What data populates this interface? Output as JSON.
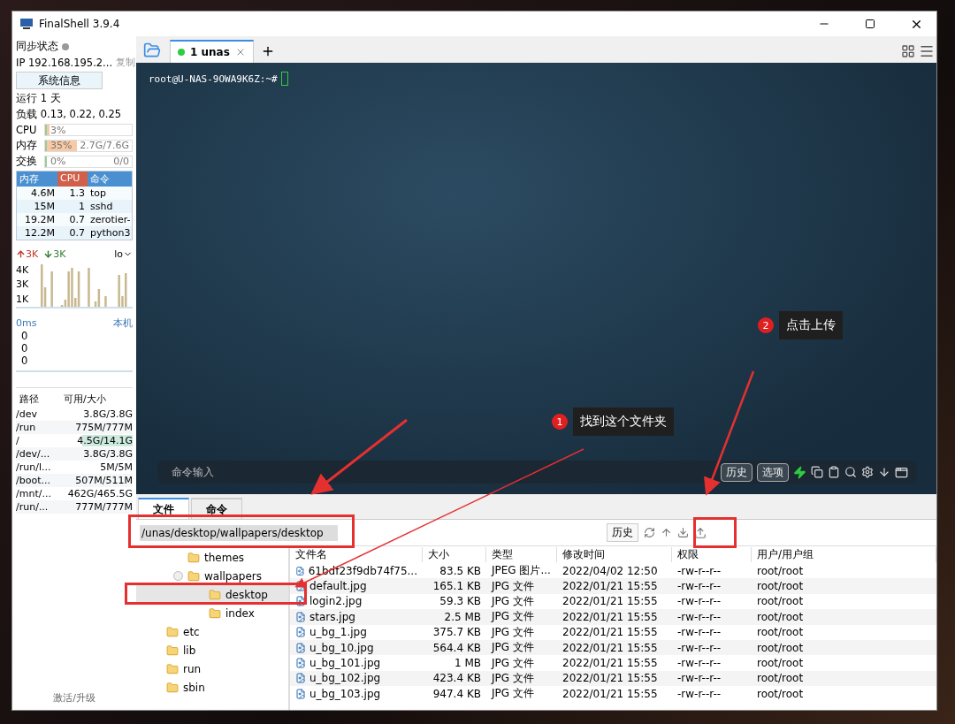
{
  "window": {
    "title": "FinalShell 3.9.4"
  },
  "sidebar": {
    "sync_label": "同步状态",
    "sync_on": false,
    "ip": "IP 192.168.195.2...",
    "copy": "复制",
    "sysinfo_button": "系统信息",
    "uptime": "运行 1 天",
    "load": "负载 0.13, 0.22, 0.25",
    "meters": [
      {
        "label": "CPU",
        "reading": "3%",
        "level": 0.03
      },
      {
        "label": "内存",
        "reading": "35%",
        "level": 0.35,
        "detail": "2.7G/7.6G"
      },
      {
        "label": "交换",
        "reading": "0%",
        "level": 0,
        "detail": "0/0"
      }
    ],
    "process_columns": [
      "内存",
      "CPU",
      "命令"
    ],
    "processes": [
      [
        "4.6M",
        "1.3",
        "top"
      ],
      [
        "15M",
        "1",
        "sshd"
      ],
      [
        "19.2M",
        "0.7",
        "zerotier-"
      ],
      [
        "12.2M",
        "0.7",
        "python3"
      ]
    ],
    "network": {
      "up": "3K",
      "down": "3K",
      "interface": "lo",
      "tick_labels": [
        "4K",
        "3K",
        "1K"
      ]
    },
    "latency": {
      "reading": "0ms",
      "host": "本机",
      "values": [
        "0",
        "0",
        "0"
      ]
    },
    "disk_columns": [
      "路径",
      "可用/大小"
    ],
    "disks": [
      {
        "path": "/dev",
        "usage": "3.8G/3.8G",
        "highlighted": false
      },
      {
        "path": "/run",
        "usage": "775M/777M",
        "highlighted": false
      },
      {
        "path": "/",
        "usage": "4.5G/14.1G",
        "highlighted": true
      },
      {
        "path": "/dev/...",
        "usage": "3.8G/3.8G",
        "highlighted": false
      },
      {
        "path": "/run/l...",
        "usage": "5M/5M",
        "highlighted": false
      },
      {
        "path": "/boot...",
        "usage": "507M/511M",
        "highlighted": false
      },
      {
        "path": "/mnt/...",
        "usage": "462G/465.5G",
        "highlighted": false
      },
      {
        "path": "/run/...",
        "usage": "777M/777M",
        "highlighted": false
      }
    ],
    "footer": "激活/升级"
  },
  "session_tabs": [
    {
      "label": "1 unas",
      "selected": true,
      "connected": true
    }
  ],
  "terminal": {
    "prompt": "root@U-NAS-9OWA9K6Z:~#",
    "command_placeholder": "命令输入",
    "buttons": [
      "历史",
      "选项"
    ]
  },
  "file_panel": {
    "tabs": [
      {
        "label": "文件",
        "selected": true
      },
      {
        "label": "命令",
        "selected": false
      }
    ],
    "path": "/unas/desktop/wallpapers/desktop",
    "history_button": "历史",
    "tree": [
      {
        "children": [
          {
            "name": "themes",
            "selected": false
          },
          {
            "name": "wallpapers",
            "selected": false,
            "expanded": true,
            "children": [
              {
                "name": "desktop",
                "selected": true
              },
              {
                "name": "index",
                "selected": false
              }
            ]
          }
        ]
      },
      {
        "name": "etc",
        "selected": false
      },
      {
        "name": "lib",
        "selected": false
      },
      {
        "name": "run",
        "selected": false
      },
      {
        "name": "sbin",
        "selected": false
      }
    ],
    "columns": [
      "文件名",
      "大小",
      "类型",
      "修改时间",
      "权限",
      "用户/用户组"
    ],
    "files": [
      [
        "61bdf23f9db74f75...",
        "83.5 KB",
        "JPEG 图片...",
        "2022/04/02 12:50",
        "-rw-r--r--",
        "root/root"
      ],
      [
        "default.jpg",
        "165.1 KB",
        "JPG 文件",
        "2022/01/21 15:55",
        "-rw-r--r--",
        "root/root"
      ],
      [
        "login2.jpg",
        "59.3 KB",
        "JPG 文件",
        "2022/01/21 15:55",
        "-rw-r--r--",
        "root/root"
      ],
      [
        "stars.jpg",
        "2.5 MB",
        "JPG 文件",
        "2022/01/21 15:55",
        "-rw-r--r--",
        "root/root"
      ],
      [
        "u_bg_1.jpg",
        "375.7 KB",
        "JPG 文件",
        "2022/01/21 15:55",
        "-rw-r--r--",
        "root/root"
      ],
      [
        "u_bg_10.jpg",
        "564.4 KB",
        "JPG 文件",
        "2022/01/21 15:55",
        "-rw-r--r--",
        "root/root"
      ],
      [
        "u_bg_101.jpg",
        "1 MB",
        "JPG 文件",
        "2022/01/21 15:55",
        "-rw-r--r--",
        "root/root"
      ],
      [
        "u_bg_102.jpg",
        "423.4 KB",
        "JPG 文件",
        "2022/01/21 15:55",
        "-rw-r--r--",
        "root/root"
      ],
      [
        "u_bg_103.jpg",
        "947.4 KB",
        "JPG 文件",
        "2022/01/21 15:55",
        "-rw-r--r--",
        "root/root"
      ]
    ]
  },
  "annotations": [
    {
      "number": "1",
      "text": "找到这个文件夹"
    },
    {
      "number": "2",
      "text": "点击上传"
    }
  ]
}
